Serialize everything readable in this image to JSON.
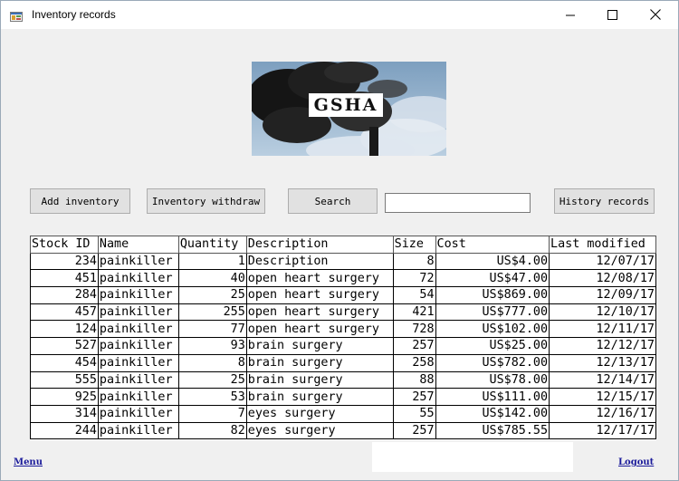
{
  "window": {
    "title": "Inventory records",
    "icons": {
      "app": "inventory-app-icon",
      "minimize": "minimize-icon",
      "maximize": "maximize-icon",
      "close": "close-icon"
    }
  },
  "banner": {
    "label": "GSHA",
    "image": "smokestack-sky-image"
  },
  "toolbar": {
    "add_label": "Add inventory",
    "withdraw_label": "Inventory withdraw",
    "search_label": "Search",
    "search_value": "",
    "history_label": "History records"
  },
  "grid": {
    "columns": [
      "Stock ID",
      "Name",
      "Quantity",
      "Description",
      "Size",
      "Cost",
      "Last modified"
    ],
    "rows": [
      [
        "234",
        "painkiller",
        "1",
        "Description",
        "8",
        "US$4.00",
        "12/07/17"
      ],
      [
        "451",
        "painkiller",
        "40",
        "open heart surgery",
        "72",
        "US$47.00",
        "12/08/17"
      ],
      [
        "284",
        "painkiller",
        "25",
        "open heart surgery",
        "54",
        "US$869.00",
        "12/09/17"
      ],
      [
        "457",
        "painkiller",
        "255",
        "open heart surgery",
        "421",
        "US$777.00",
        "12/10/17"
      ],
      [
        "124",
        "painkiller",
        "77",
        "open heart surgery",
        "728",
        "US$102.00",
        "12/11/17"
      ],
      [
        "527",
        "painkiller",
        "93",
        "brain surgery",
        "257",
        "US$25.00",
        "12/12/17"
      ],
      [
        "454",
        "painkiller",
        "8",
        "brain surgery",
        "258",
        "US$782.00",
        "12/13/17"
      ],
      [
        "555",
        "painkiller",
        "25",
        "brain surgery",
        "88",
        "US$78.00",
        "12/14/17"
      ],
      [
        "925",
        "painkiller",
        "53",
        "brain surgery",
        "257",
        "US$111.00",
        "12/15/17"
      ],
      [
        "314",
        "painkiller",
        "7",
        "eyes surgery",
        "55",
        "US$142.00",
        "12/16/17"
      ],
      [
        "244",
        "painkiller",
        "82",
        "eyes surgery",
        "257",
        "US$785.55",
        "12/17/17"
      ]
    ]
  },
  "footer": {
    "menu_label": "Menu",
    "logout_label": "Logout"
  }
}
